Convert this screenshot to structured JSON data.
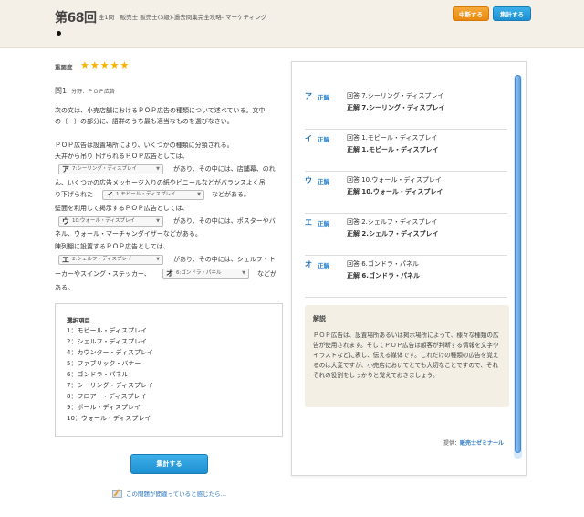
{
  "header": {
    "round": "第68回",
    "subtitle": "全1問　販売士 販売士(3級)-過去問集完全攻略- マーケティング",
    "suspend_label": "中断する",
    "count_label": "集計する"
  },
  "question": {
    "importance_label": "重要度",
    "stars": "★★★★★",
    "stars_value": 5,
    "number": "問1",
    "field": "分野：ＰＯＰ広告"
  },
  "intro": [
    "次の文は、小売店舗におけるＰＯＰ広告の種類について述べている。文中",
    "の〔　〕の部分に、語群のうち最も適当なものを選びなさい。"
  ],
  "body": {
    "l1": "ＰＯＰ広告は設置場所により、いくつかの種類に分類される。",
    "l2": "天井から吊り下げられるＰＯＰ広告としては、",
    "l3": "があり、その中には、店舗幕、のれ",
    "l4": "ん、いくつかの広告メッセージ入りの紙やビニールなどがバランスよく吊",
    "l5a": "り下げられた",
    "l5b": "などがある。",
    "l6": "壁面を利用して掲示するＰＯＰ広告としては、",
    "l7": "があり、その中には、ポスターやバ",
    "l8": "ネル、ウォール・マーチャンダイザーなどがある。",
    "l9": "陳列棚に設置するＰＯＰ広告としては、",
    "l10": "があり、その中には、シェルフ・ト",
    "l11a": "ーカーやスイング・ステッカー、",
    "l11b": "などが",
    "l12": "ある。"
  },
  "selects": {
    "a": {
      "label": "ア",
      "value": "7:シーリング・ディスプレイ"
    },
    "i": {
      "label": "イ",
      "value": "1:モビール・ディスプレイ"
    },
    "u": {
      "label": "ウ",
      "value": "10:ウォール・ディスプレイ"
    },
    "e": {
      "label": "エ",
      "value": "2:シェルフ・ディスプレイ"
    },
    "o": {
      "label": "オ",
      "value": "6:ゴンドラ・パネル"
    }
  },
  "choices": {
    "title": "選択項目",
    "items": [
      "1：モビール・ディスプレイ",
      "2：シェルフ・ディスプレイ",
      "4：カウンター・ディスプレイ",
      "5：ファブリック・バナー",
      "6：ゴンドラ・パネル",
      "7：シーリング・ディスプレイ",
      "8：フロアー・ディスプレイ",
      "9：ボール・ディスプレイ",
      "10：ウォール・ディスプレイ"
    ]
  },
  "count_button": "集計する",
  "report_link": "この問題が間違っていると感じたら…",
  "answers": [
    {
      "label": "ア",
      "result": "正解",
      "user": "回答 7.シーリング・ディスプレイ",
      "correct": "正解 7.シーリング・ディスプレイ"
    },
    {
      "label": "イ",
      "result": "正解",
      "user": "回答 1.モビール・ディスプレイ",
      "correct": "正解 1.モビール・ディスプレイ"
    },
    {
      "label": "ウ",
      "result": "正解",
      "user": "回答 10.ウォール・ディスプレイ",
      "correct": "正解 10.ウォール・ディスプレイ"
    },
    {
      "label": "エ",
      "result": "正解",
      "user": "回答 2.シェルフ・ディスプレイ",
      "correct": "正解 2.シェルフ・ディスプレイ"
    },
    {
      "label": "オ",
      "result": "正解",
      "user": "回答 6.ゴンドラ・パネル",
      "correct": "正解 6.ゴンドラ・パネル"
    }
  ],
  "explanation": {
    "title": "解説",
    "text": "ＰＯＰ広告は、設置場所あるいは掲示場所によって、様々な種類の広告が使用されます。そしてＰＯＰ広告は顧客が判断する情報を文字やイラストなどに表し、伝える媒体です。これだけの種類の広告を覚えるのは大変ですが、小売店においてとても大切なことですので、それぞれの役割をしっかりと覚えておきましょう。"
  },
  "credit": {
    "prefix": "提供：",
    "link": "販売士ゼミナール"
  },
  "colors": {
    "accent_blue": "#1e8fd0",
    "accent_orange": "#e8890f",
    "star": "#f5b300"
  }
}
